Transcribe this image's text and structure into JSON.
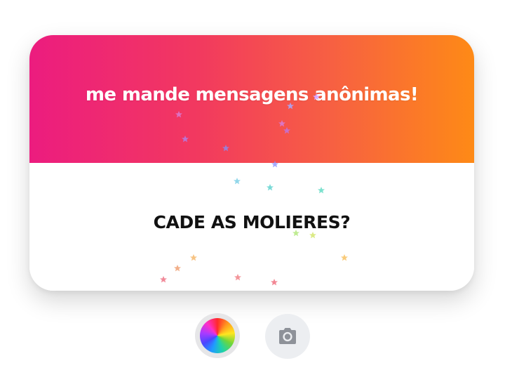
{
  "card": {
    "title": "me mande mensagens anônimas!",
    "message": "CADE AS MOLIERES?"
  },
  "controls": {
    "color_button_icon": "color-wheel-icon",
    "camera_button_icon": "camera-icon"
  },
  "theme": {
    "gradient_start": "#ec1c7f",
    "gradient_end": "#fe8a16",
    "message_color": "#111111",
    "control_bg": "#eceef1"
  },
  "decorations": {
    "confetti_icon": "star-icon"
  }
}
